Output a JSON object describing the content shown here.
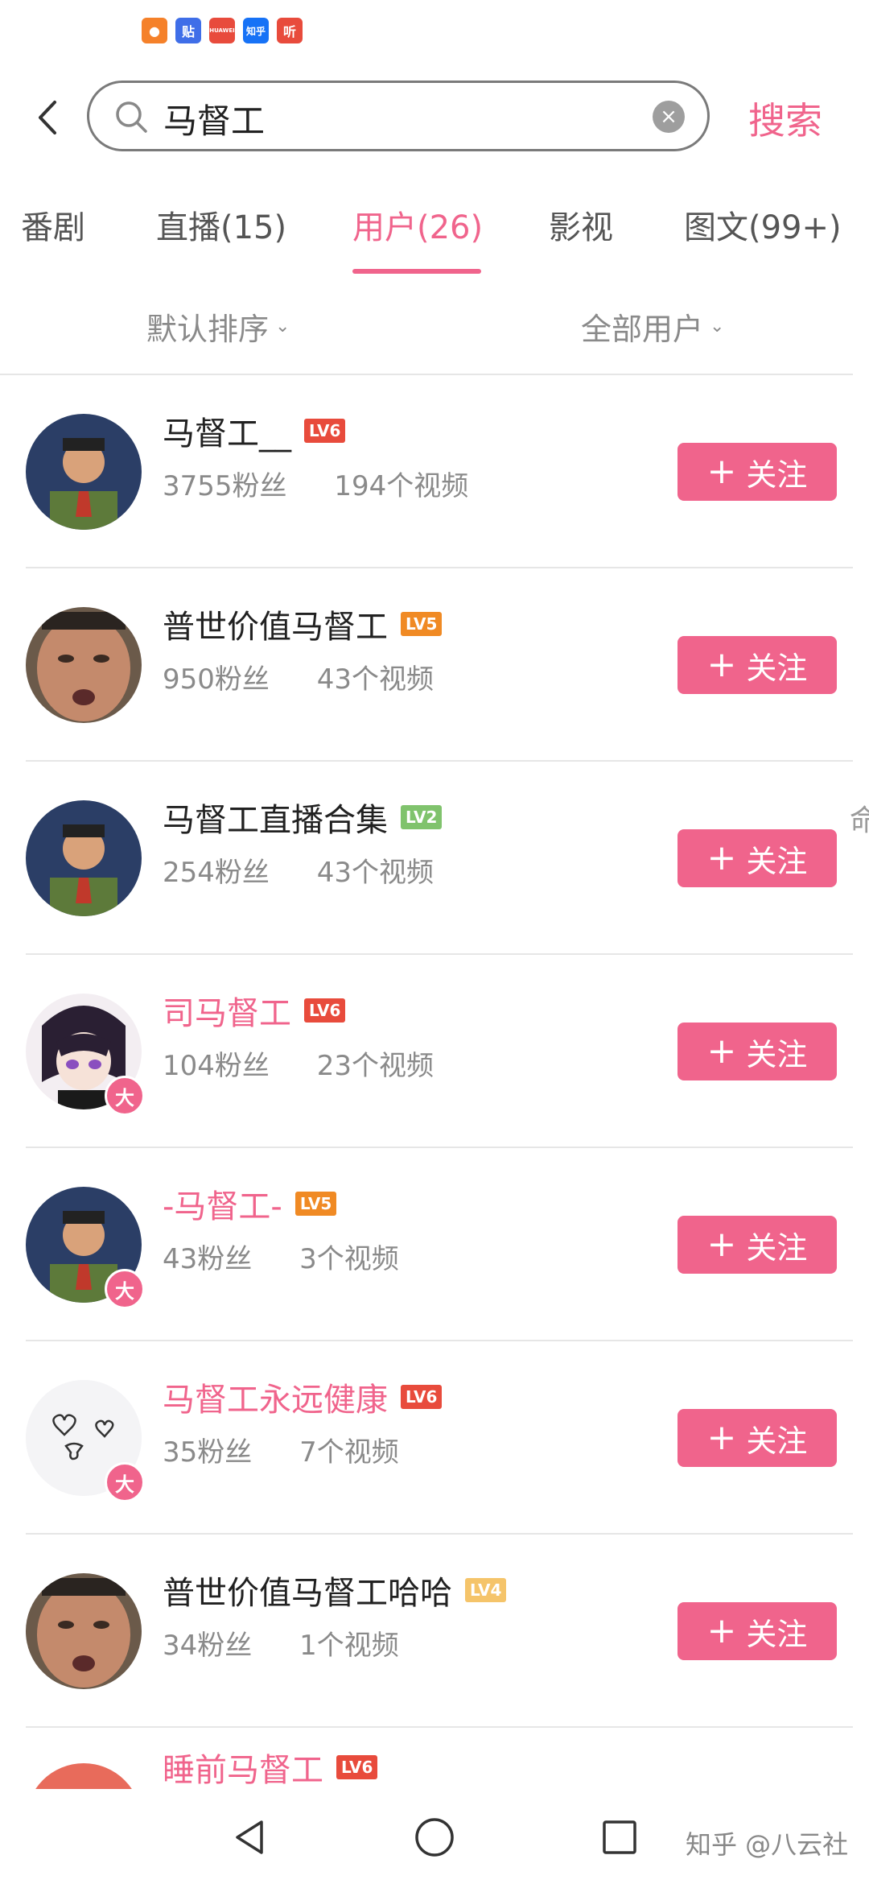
{
  "status_bar": {
    "app_icons": [
      {
        "name": "taobao-icon",
        "glyph": "●",
        "color": "#f5812a"
      },
      {
        "name": "tieba-icon",
        "glyph": "贴",
        "color": "#3f6ee8"
      },
      {
        "name": "huawei-icon",
        "glyph": "HUAWEI",
        "color": "#e84b3c"
      },
      {
        "name": "zhihu-icon",
        "glyph": "知乎",
        "color": "#1772f6"
      },
      {
        "name": "ting-icon",
        "glyph": "听",
        "color": "#e84b3c"
      }
    ]
  },
  "search": {
    "query": "马督工",
    "button_label": "搜索"
  },
  "tabs": [
    {
      "label": "番剧",
      "active": false
    },
    {
      "label": "直播(15)",
      "active": false
    },
    {
      "label": "用户(26)",
      "active": true
    },
    {
      "label": "影视",
      "active": false
    },
    {
      "label": "图文(99+)",
      "active": false
    }
  ],
  "filters": {
    "sort": "默认排序",
    "scope": "全部用户"
  },
  "users": [
    {
      "name": "马督工__",
      "level": "LV6",
      "followers": "3755粉丝",
      "videos": "194个视频",
      "highlight": false,
      "badge": "",
      "follow_label": "关注"
    },
    {
      "name": "普世价值马督工",
      "level": "LV5",
      "followers": "950粉丝",
      "videos": "43个视频",
      "highlight": false,
      "badge": "",
      "follow_label": "关注"
    },
    {
      "name": "马督工直播合集",
      "level": "LV2",
      "followers": "254粉丝",
      "videos": "43个视频",
      "highlight": false,
      "badge": "",
      "follow_label": "关注"
    },
    {
      "name": "司马督工",
      "level": "LV6",
      "followers": "104粉丝",
      "videos": "23个视频",
      "highlight": true,
      "badge": "大",
      "follow_label": "关注"
    },
    {
      "name": "-马督工-",
      "level": "LV5",
      "followers": "43粉丝",
      "videos": "3个视频",
      "highlight": true,
      "badge": "大",
      "follow_label": "关注"
    },
    {
      "name": "马督工永远健康",
      "level": "LV6",
      "followers": "35粉丝",
      "videos": "7个视频",
      "highlight": true,
      "badge": "大",
      "follow_label": "关注"
    },
    {
      "name": "普世价值马督工哈哈",
      "level": "LV4",
      "followers": "34粉丝",
      "videos": "1个视频",
      "highlight": false,
      "badge": "",
      "follow_label": "关注"
    }
  ],
  "partial_user": {
    "name": "睡前马督工",
    "level": "LV6"
  },
  "side_hint": "命",
  "watermark": "知乎 @八云社"
}
